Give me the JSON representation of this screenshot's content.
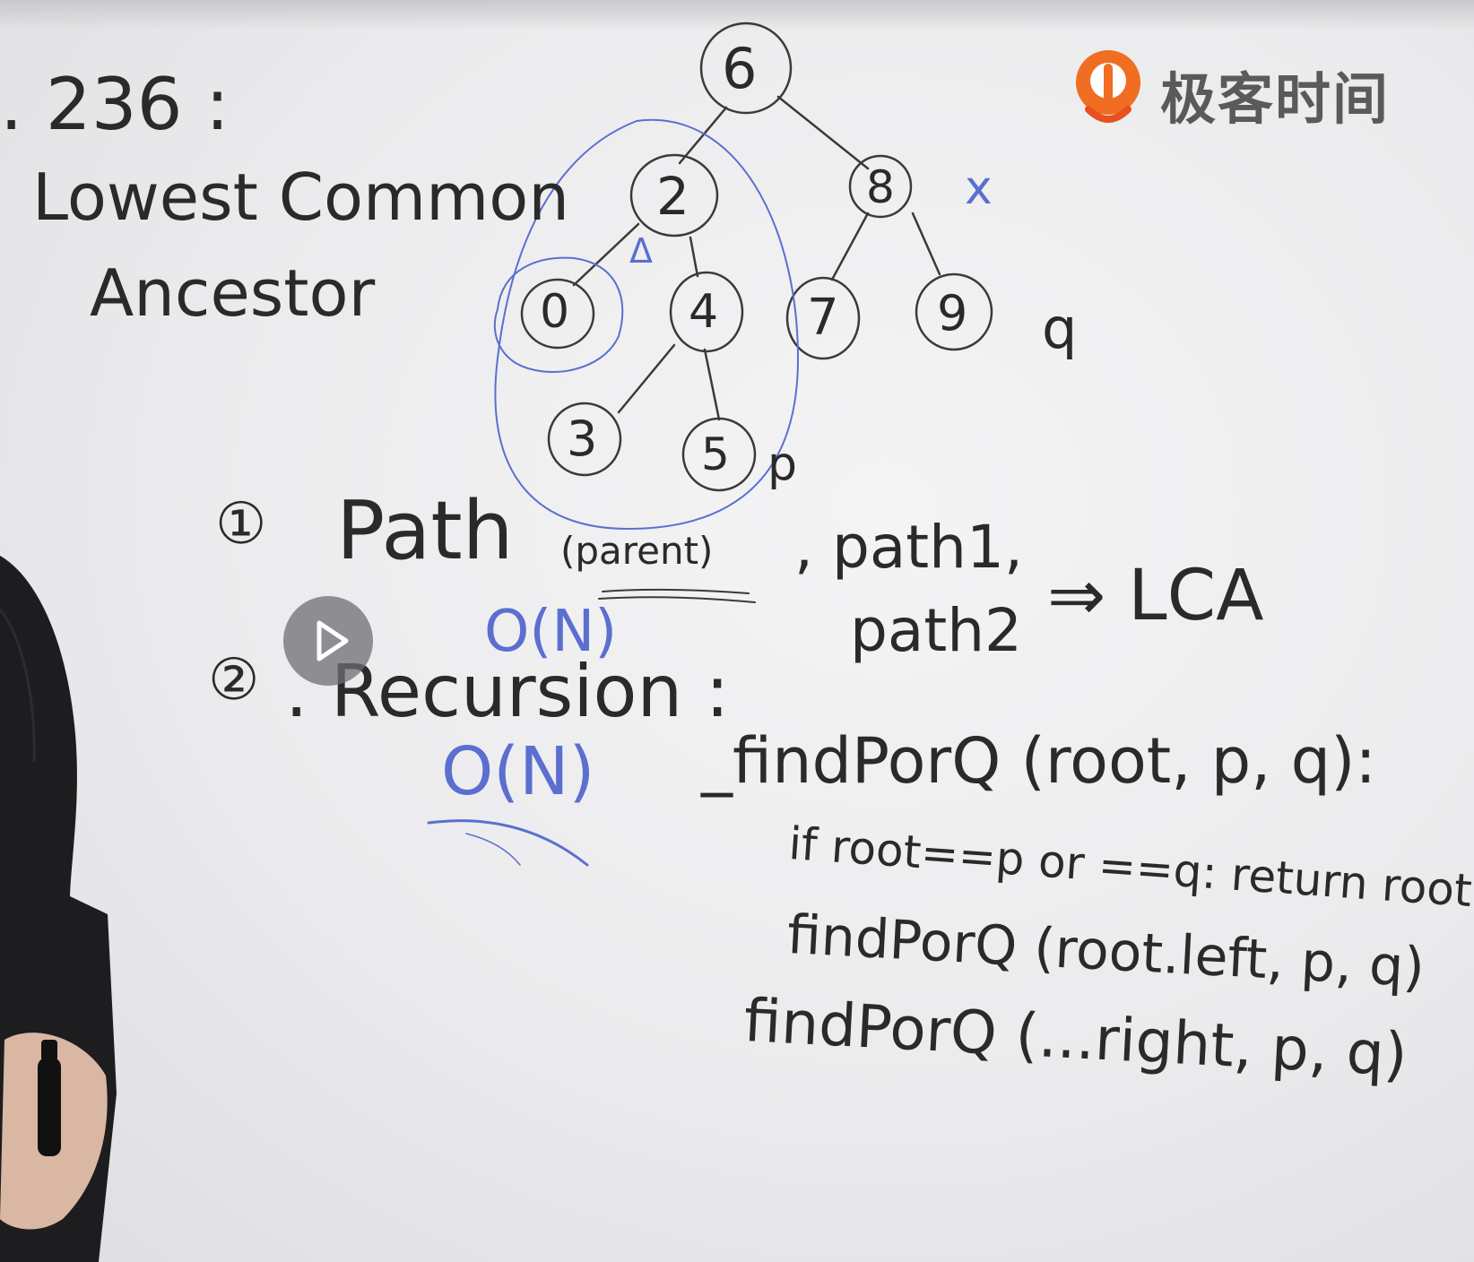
{
  "board": {
    "problem_number": ". 236 :",
    "title_line1": "Lowest Common",
    "title_line2": "Ancestor",
    "tree_nodes": [
      "6",
      "2",
      "8",
      "0",
      "4",
      "7",
      "9",
      "3",
      "5"
    ],
    "mark_x": "x",
    "mark_p": "p",
    "mark_q": "q",
    "mark_triangle": "Δ",
    "method1_num": "①",
    "method1_label": "Path",
    "method1_parent": "(parent)",
    "method1_path1": ", path1,",
    "method1_path2": "path2",
    "method1_arrow": "⇒ LCA",
    "method1_complexity": "O(N)",
    "method2_num": "②",
    "method2_label": ". Recursion :",
    "method2_complexity": "O(N)",
    "code_line1": "_findPorQ (root, p, q):",
    "code_line2": "if root==p or ==q: return root",
    "code_line3": "findPorQ (root.left, p, q)",
    "code_line4": "findPorQ (...right, p, q)"
  },
  "logo": {
    "text": "极客时间",
    "brand_color": "#f06d22"
  },
  "player": {
    "play_icon": "play-icon"
  }
}
